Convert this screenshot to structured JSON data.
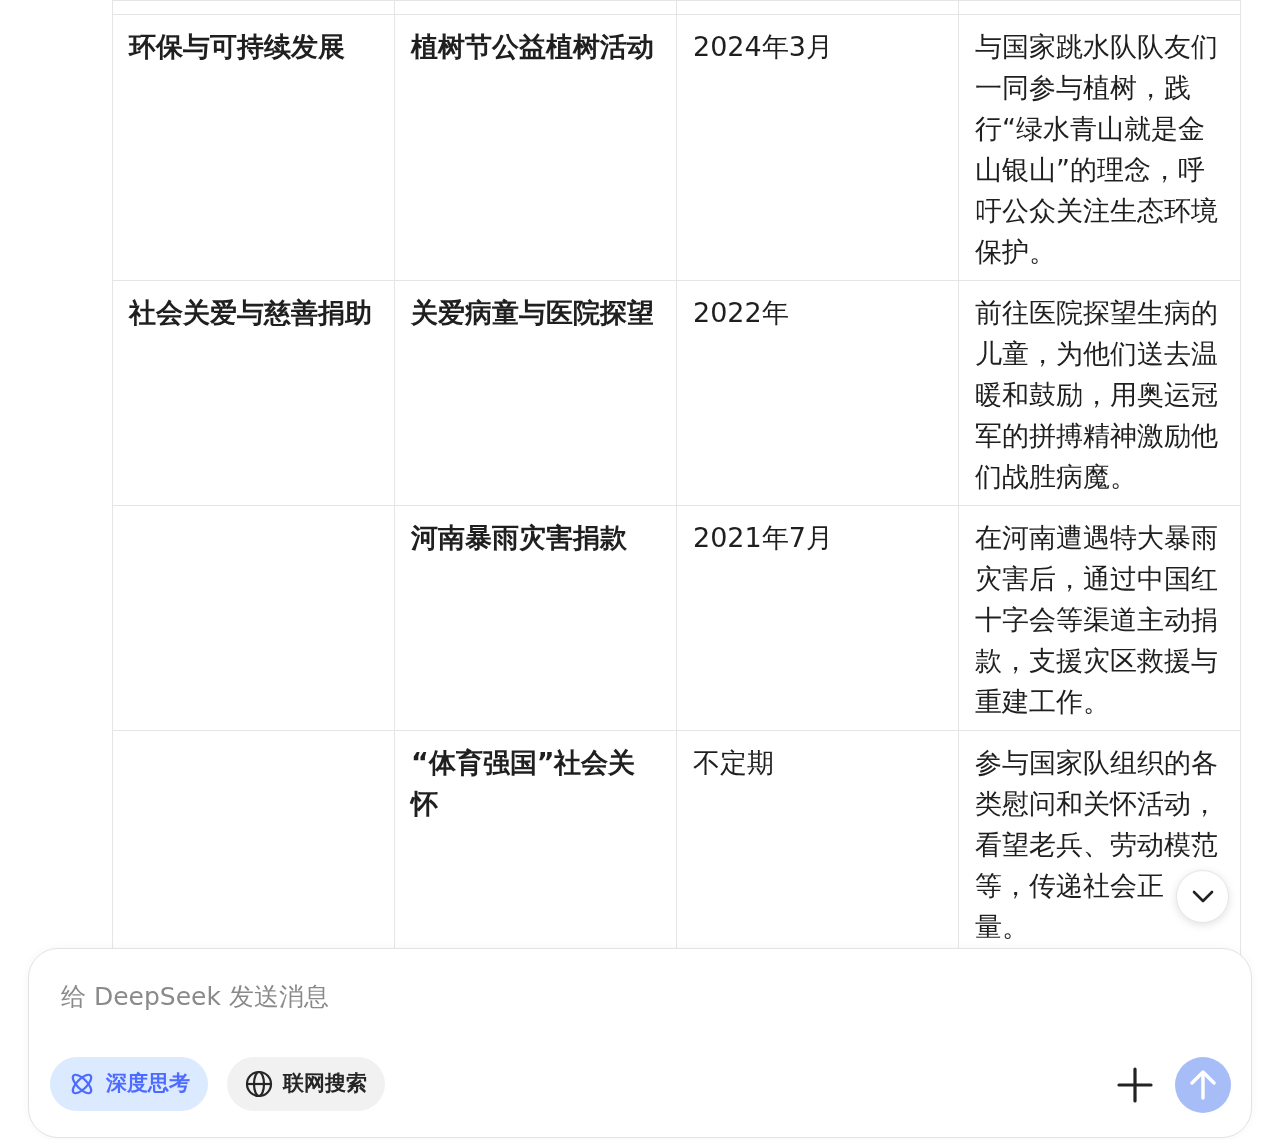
{
  "table": {
    "rows": [
      {
        "cells": [
          "环保与可持续发展",
          "植树节公益植树活动",
          "2024年3月",
          "与国家跳水队队友们一同参与植树，践行“绿水青山就是金山银山”的理念，呼吁公众关注生态环境保护。"
        ]
      },
      {
        "cells": [
          "社会关爱与慈善捐助",
          "关爱病童与医院探望",
          "2022年",
          "前往医院探望生病的儿童，为他们送去温暖和鼓励，用奥运冠军的拼搏精神激励他们战胜病魔。"
        ]
      },
      {
        "cells": [
          "",
          "河南暴雨灾害捐款",
          "2021年7月",
          "在河南遭遇特大暴雨灾害后，通过中国红十字会等渠道主动捐款，支援灾区救援与重建工作。"
        ]
      },
      {
        "cells": [
          "",
          "“体育强国”社会关怀",
          "不定期",
          [
            "参与国家队组织的各类慰问和关怀活动，看望老兵、劳动模范",
            "等，传递社会正",
            "量。"
          ]
        ]
      }
    ]
  },
  "composer": {
    "placeholder": "给 DeepSeek 发送消息",
    "toggles": [
      {
        "kind": "think",
        "label": "深度思考",
        "selected": true
      },
      {
        "kind": "search",
        "label": "联网搜索",
        "selected": false
      }
    ]
  }
}
